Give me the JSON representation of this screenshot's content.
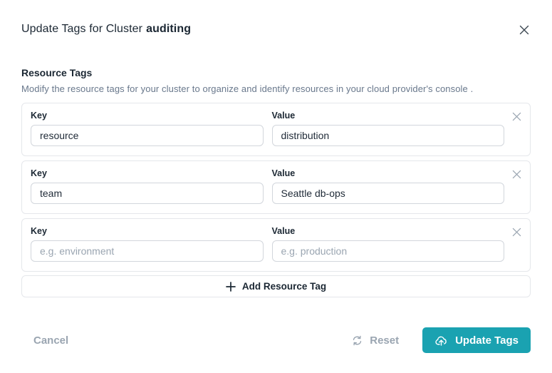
{
  "modal": {
    "title_prefix": "Update Tags for Cluster",
    "cluster_name": "auditing"
  },
  "section": {
    "heading": "Resource Tags",
    "description": "Modify the resource tags for your cluster to organize and identify resources in your cloud provider's console ."
  },
  "labels": {
    "key": "Key",
    "value": "Value"
  },
  "tag_rows": [
    {
      "key": "resource",
      "value": "distribution"
    },
    {
      "key": "team",
      "value": "Seattle db-ops"
    },
    {
      "key": "",
      "value": "",
      "key_placeholder": "e.g. environment",
      "value_placeholder": "e.g. production"
    }
  ],
  "add_button": {
    "label": "Add Resource Tag"
  },
  "footer": {
    "cancel_label": "Cancel",
    "reset_label": "Reset",
    "update_label": "Update Tags"
  },
  "icons": {
    "close": "close-icon",
    "remove_row": "remove-tag-icon",
    "add": "plus-icon",
    "reset": "refresh-icon",
    "update": "cloud-upload-icon"
  },
  "colors": {
    "accent_teal": "#1aa2b1",
    "text_dark": "#1b2733",
    "text_gray": "#69788c",
    "muted_gray": "#9aa5b1",
    "card_border": "#e5e7eb",
    "input_border": "#d2d6dc"
  }
}
